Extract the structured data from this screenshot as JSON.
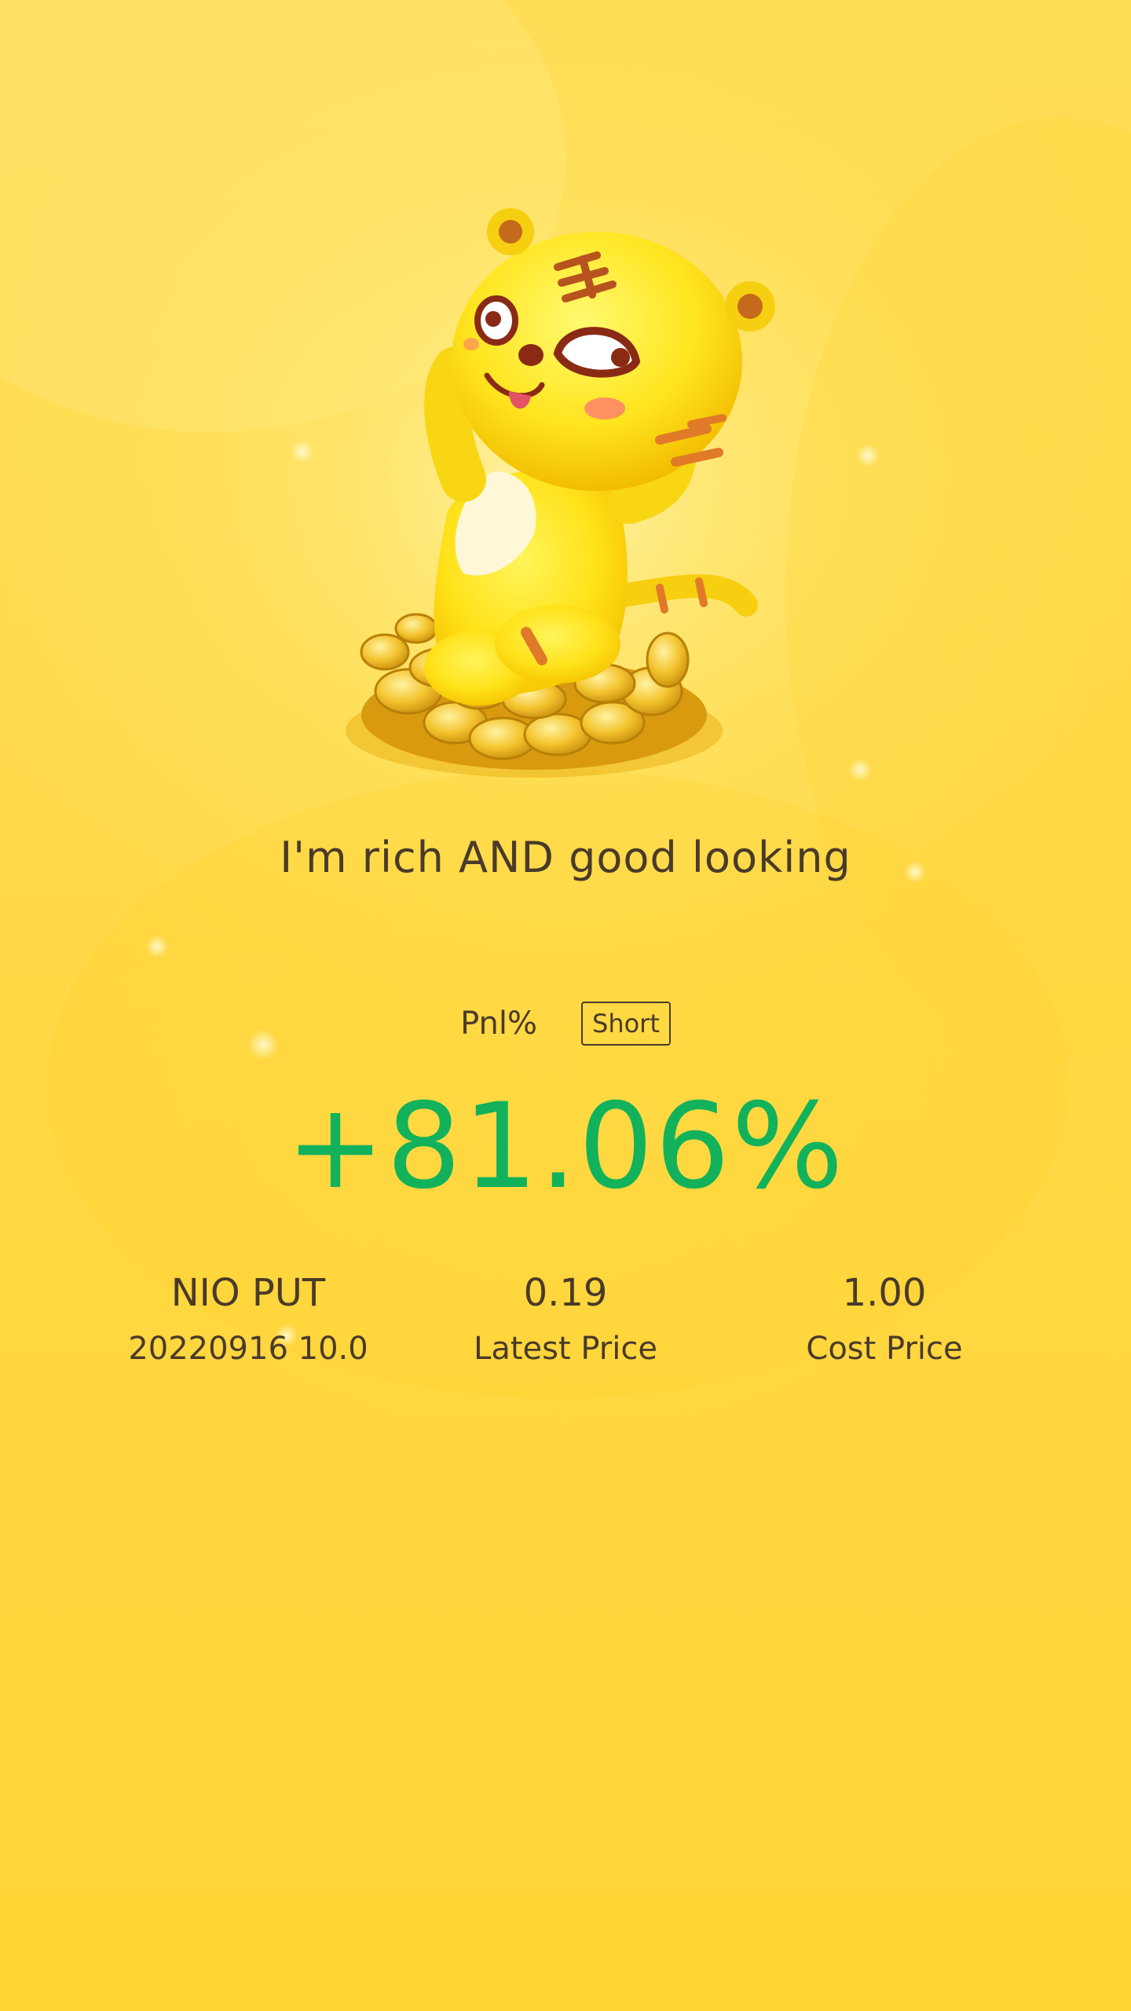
{
  "slogan": "I'm rich AND good looking",
  "pnl": {
    "label": "Pnl%",
    "direction": "Short",
    "value": "+81.06%",
    "value_color": "#11b25b"
  },
  "stats": [
    {
      "value": "NIO PUT",
      "label": "20220916 10.0"
    },
    {
      "value": "0.19",
      "label": "Latest Price"
    },
    {
      "value": "1.00",
      "label": "Cost Price"
    }
  ],
  "colors": {
    "background": "#ffd83c",
    "text": "#4a3a2a",
    "positive": "#11b25b"
  },
  "mascot": {
    "icon": "tiger-on-gold-coins-icon"
  }
}
